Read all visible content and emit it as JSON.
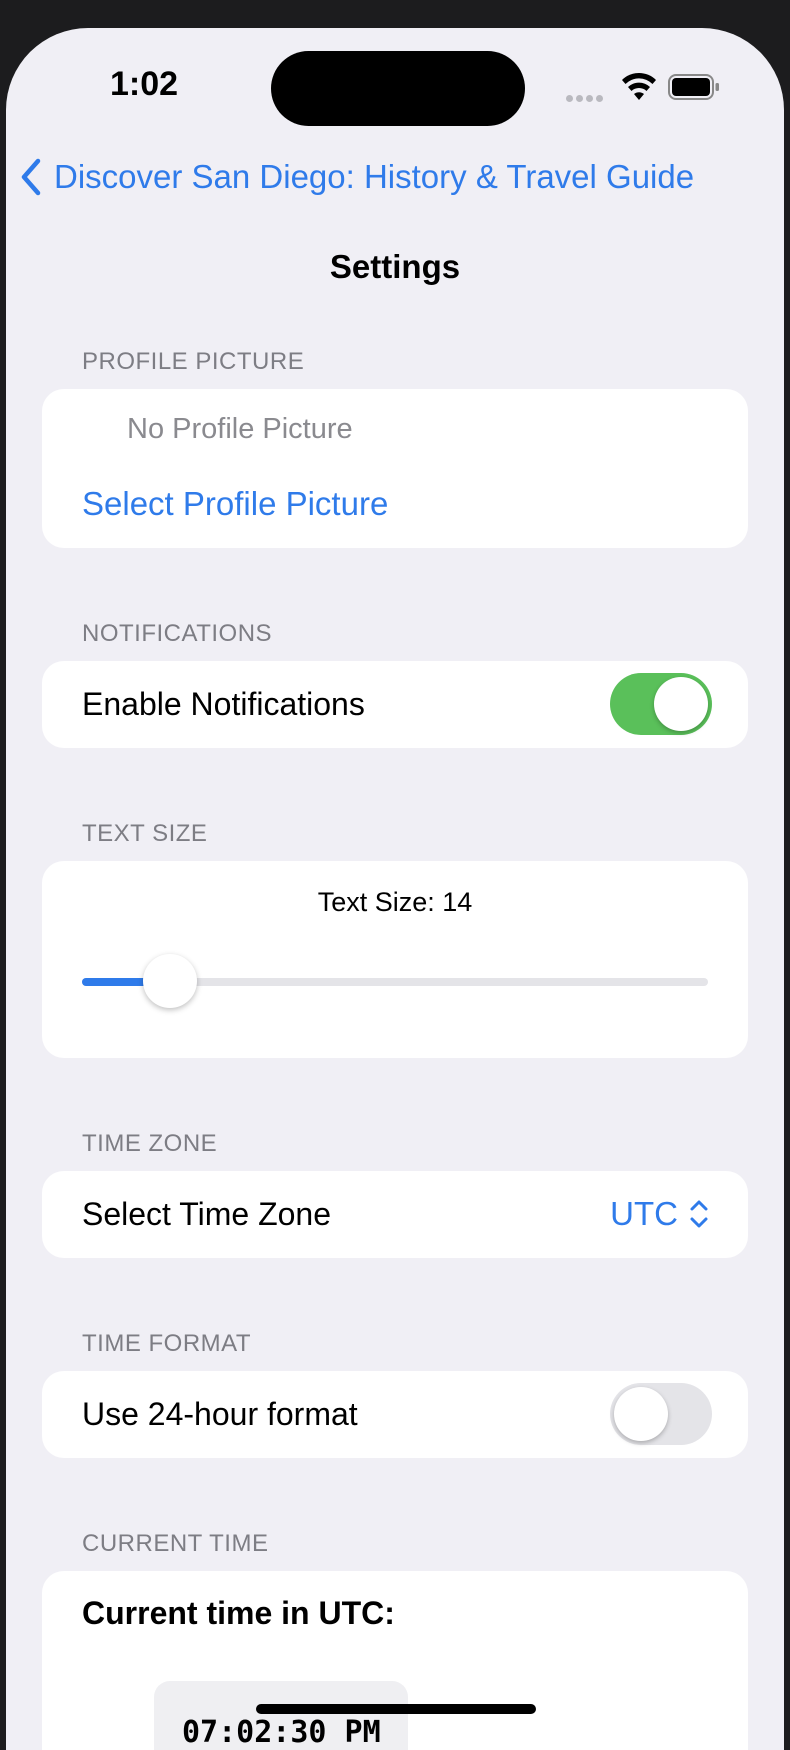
{
  "status_bar": {
    "time": "1:02"
  },
  "nav": {
    "back_label": "Discover San Diego: History & Travel Guide",
    "title": "Settings"
  },
  "profile": {
    "section_label": "PROFILE PICTURE",
    "placeholder_text": "No Profile Picture",
    "select_label": "Select Profile Picture"
  },
  "notifications": {
    "section_label": "NOTIFICATIONS",
    "row_label": "Enable Notifications",
    "enabled": true
  },
  "text_size": {
    "section_label": "TEXT SIZE",
    "caption": "Text Size: 14",
    "slider_fraction": 0.14
  },
  "time_zone": {
    "section_label": "TIME ZONE",
    "row_label": "Select Time Zone",
    "value": "UTC"
  },
  "time_format": {
    "section_label": "TIME FORMAT",
    "row_label": "Use 24-hour format",
    "enabled": false
  },
  "current_time": {
    "section_label": "CURRENT TIME",
    "heading": "Current time in UTC:",
    "value": "07:02:30 PM"
  },
  "colors": {
    "accent": "#2f7bea",
    "toggle_on": "#5ac05a",
    "toggle_off": "#e4e4e8"
  }
}
